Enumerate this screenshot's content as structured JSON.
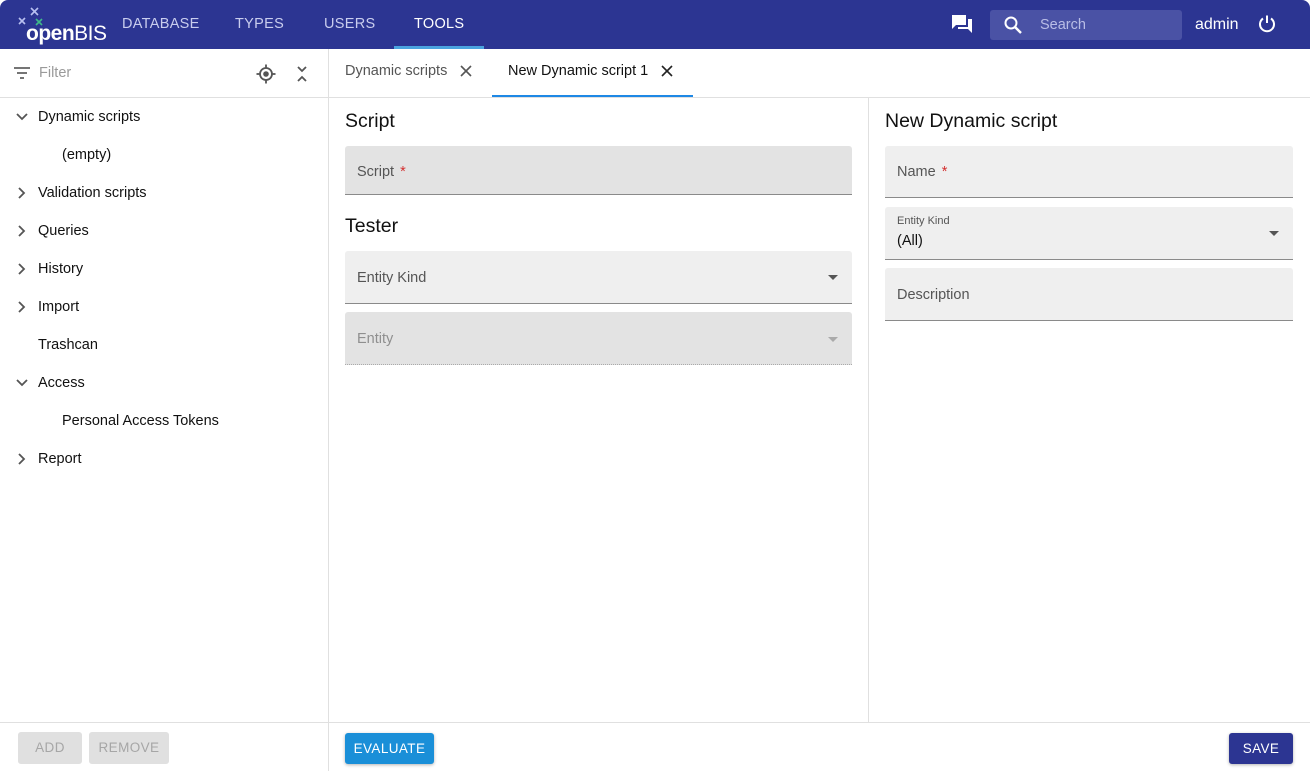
{
  "colors": {
    "topbar": "#2c3592",
    "accent": "#1e88e5",
    "evaluate_button": "#1a8fd8",
    "save_button": "#2c3592",
    "required": "#d32f2f"
  },
  "app": {
    "logo_text_bold": "open",
    "logo_text_regular": "BIS"
  },
  "nav": {
    "items": [
      "DATABASE",
      "TYPES",
      "USERS",
      "TOOLS"
    ],
    "active": "TOOLS"
  },
  "header": {
    "search_placeholder": "Search",
    "user": "admin",
    "icons": [
      "chat-icon",
      "search-icon",
      "power-icon"
    ]
  },
  "sidebar": {
    "filter_placeholder": "Filter",
    "tree": [
      {
        "label": "Dynamic scripts",
        "expanded": true,
        "icon": "chevron-down-icon"
      },
      {
        "label": "(empty)",
        "child": true
      },
      {
        "label": "Validation scripts",
        "expanded": false,
        "icon": "chevron-right-icon"
      },
      {
        "label": "Queries",
        "expanded": false,
        "icon": "chevron-right-icon"
      },
      {
        "label": "History",
        "expanded": false,
        "icon": "chevron-right-icon"
      },
      {
        "label": "Import",
        "expanded": false,
        "icon": "chevron-right-icon"
      },
      {
        "label": "Trashcan"
      },
      {
        "label": "Access",
        "expanded": true,
        "icon": "chevron-down-icon"
      },
      {
        "label": "Personal Access Tokens",
        "child": true
      },
      {
        "label": "Report",
        "expanded": false,
        "icon": "chevron-right-icon"
      }
    ],
    "add_label": "ADD",
    "remove_label": "REMOVE"
  },
  "tabs": [
    {
      "label": "Dynamic scripts",
      "active": false
    },
    {
      "label": "New Dynamic script 1",
      "active": true
    }
  ],
  "script_panel": {
    "title": "Script",
    "script_label": "Script",
    "required_mark": "*",
    "tester_title": "Tester",
    "entity_kind_label": "Entity Kind",
    "entity_label": "Entity",
    "evaluate_label": "EVALUATE"
  },
  "form_panel": {
    "title": "New Dynamic script",
    "name_label": "Name",
    "required_mark": "*",
    "entity_kind_label": "Entity Kind",
    "entity_kind_value": "(All)",
    "description_label": "Description",
    "save_label": "SAVE"
  }
}
